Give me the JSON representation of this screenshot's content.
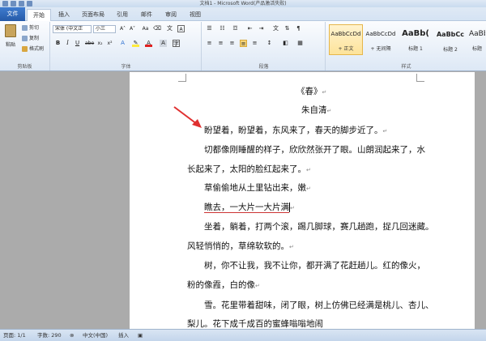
{
  "window": {
    "title": "文档1 - Microsoft Word(产品激活失败)"
  },
  "tabs": [
    "文件",
    "开始",
    "插入",
    "页面布局",
    "引用",
    "邮件",
    "审阅",
    "视图"
  ],
  "clipboard": {
    "paste": "粘贴",
    "cut": "剪切",
    "copy": "复制",
    "format_painter": "格式刷",
    "group_label": "剪贴板"
  },
  "font": {
    "name": "宋体 (中文正",
    "size": "小三",
    "group_label": "字体"
  },
  "paragraph": {
    "group_label": "段落"
  },
  "styles": {
    "items": [
      {
        "preview": "AaBbCcDd",
        "name": "+ 正文"
      },
      {
        "preview": "AaBbCcDd",
        "name": "+ 无间隔"
      },
      {
        "preview": "AaBb(",
        "name": "标题 1"
      },
      {
        "preview": "AaBbCc",
        "name": "标题 2"
      },
      {
        "preview": "AaBb",
        "name": "标题"
      }
    ],
    "group_label": "样式"
  },
  "document": {
    "title": "《春》",
    "author": "朱自清",
    "lines": [
      "盼望着，盼望着，东风来了，春天的脚步近了。",
      "切都像刚睡醒的样子，欣欣然张开了眼。山朗润起来了，水",
      "长起来了，太阳的脸红起来了。",
      "草偷偷地从土里钻出来，嫩",
      "瞧去，一大片一大片满",
      "坐着，躺着，打两个滚，踢几脚球，赛几趟跑，捉几回迷藏。",
      "风轻悄悄的，草绵软软的。",
      "树，你不让我，我不让你，都开满了花赶趟儿。红的像火，",
      "粉的像霞，白的像",
      "雪。花里带着甜味，闭了眼，树上仿佛已经满是桃儿、杏儿、",
      "梨儿。花下成千成百的蜜蜂嗡嗡地闹"
    ]
  },
  "status": {
    "page": "页面: 1/1",
    "words": "字数: 290",
    "language": "中文(中国)",
    "mode": "插入"
  }
}
